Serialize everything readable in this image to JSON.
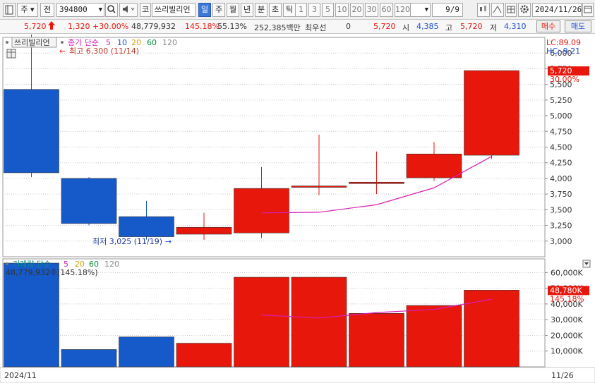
{
  "toolbar": {
    "type_label": "주",
    "market_label": "전",
    "code_value": "394800",
    "name_short": "코",
    "name_value": "쓰리빌리언",
    "periods": [
      "일",
      "주",
      "월",
      "년",
      "분",
      "초",
      "틱"
    ],
    "active_period": "일",
    "intervals": [
      "1",
      "3",
      "5",
      "10",
      "20",
      "30",
      "60",
      "120"
    ],
    "count_value": "9/9",
    "date_value": "2024/11/26"
  },
  "info": {
    "price": "5,720",
    "change": "1,320",
    "change_pct": "+30.00%",
    "volume": "48,779,932",
    "volume_ratio": "145.18%",
    "turnover": "55.13%",
    "trade_value": "252,385백만",
    "priority_label": "최우선",
    "priority_value": "0",
    "ask": "5,720",
    "open_label": "시",
    "open": "4,385",
    "high_label": "고",
    "high": "5,720",
    "low_label": "저",
    "low": "4,310",
    "buy_label": "매수",
    "sell_label": "매도"
  },
  "chart": {
    "stock_tag": "쓰리빌리언",
    "price_legend_name": "종가 단순",
    "ma_periods": [
      "5",
      "10",
      "20",
      "60",
      "120"
    ],
    "ma_colors": [
      "#d61fb5",
      "#1e4fd6",
      "#d8a000",
      "#0a8a3c",
      "#888888"
    ],
    "high_note": "최고 6,300 (11/14)",
    "low_note": "최저 3,025 (11/19)",
    "lc_label": "LC:89.09",
    "hc_label": "HC:-9.21",
    "last_price_tag": "5,720",
    "last_pct_tag": "30.00%",
    "volume_legend_name": "거래량 단순",
    "volume_ma_periods": [
      "5",
      "20",
      "60",
      "120"
    ],
    "volume_ma_colors": [
      "#d61fb5",
      "#d8a000",
      "#0a8a3c",
      "#888888"
    ],
    "volume_note": "48,779,932주(145.18%)",
    "last_volume_tag": "48,780K",
    "last_volume_pct_tag": "145.18%",
    "date_left": "2024/11",
    "date_right": "11/26",
    "up_color": "#e8170c",
    "down_color": "#1659c9"
  },
  "chart_data": {
    "type": "candlestick",
    "price_axis": {
      "min": 2750,
      "max": 6250,
      "ticks": [
        3000,
        3250,
        3500,
        3750,
        4000,
        4250,
        4500,
        4750,
        5000,
        5250,
        5500,
        5750,
        6000
      ]
    },
    "price_tick_labels": [
      "3,000",
      "3,250",
      "3,500",
      "3,750",
      "4,000",
      "4,250",
      "4,500",
      "4,750",
      "5,000",
      "5,250",
      "5,500",
      "5,750",
      "6,000"
    ],
    "candles": [
      {
        "open": 5420,
        "high": 6300,
        "low": 4020,
        "close": 4090,
        "volume": 66000
      },
      {
        "open": 4000,
        "high": 4020,
        "low": 3250,
        "close": 3280,
        "volume": 11000
      },
      {
        "open": 3390,
        "high": 3640,
        "low": 3025,
        "close": 3070,
        "volume": 19000
      },
      {
        "open": 3110,
        "high": 3450,
        "low": 3020,
        "close": 3220,
        "volume": 15000
      },
      {
        "open": 3130,
        "high": 4180,
        "low": 3050,
        "close": 3840,
        "volume": 57000
      },
      {
        "open": 3860,
        "high": 4700,
        "low": 3730,
        "close": 3880,
        "volume": 57000
      },
      {
        "open": 3920,
        "high": 4430,
        "low": 3750,
        "close": 3940,
        "volume": 34000
      },
      {
        "open": 4010,
        "high": 4580,
        "low": 3960,
        "close": 4390,
        "volume": 39000
      },
      {
        "open": 4370,
        "high": 5720,
        "low": 4310,
        "close": 5720,
        "volume": 48780
      }
    ],
    "ma5": [
      null,
      null,
      null,
      null,
      3450,
      3460,
      3580,
      3850,
      4350
    ],
    "volume_axis": {
      "min": 0,
      "max": 66000,
      "ticks": [
        10000,
        20000,
        30000,
        40000,
        50000,
        60000
      ]
    },
    "volume_tick_labels": [
      "10,000K",
      "20,000K",
      "30,000K",
      "40,000K",
      "50,000K",
      "60,000K"
    ],
    "volume_ma5": [
      null,
      null,
      null,
      null,
      33000,
      31000,
      34500,
      36500,
      43000
    ]
  }
}
